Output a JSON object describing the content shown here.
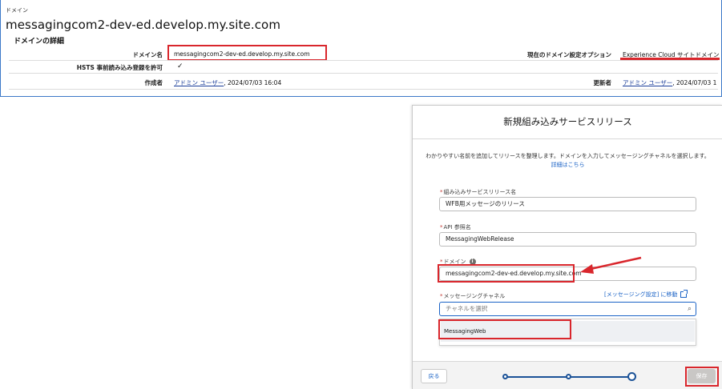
{
  "domain": {
    "object_type": "ドメイン",
    "title": "messagingcom2-dev-ed.develop.my.site.com",
    "section_title": "ドメインの詳細",
    "fields": {
      "domain_name_label": "ドメイン名",
      "domain_name_value": "messagingcom2-dev-ed.develop.my.site.com",
      "hsts_label": "HSTS 事前読み込み登録を許可",
      "hsts_value": "✓",
      "created_by_label": "作成者",
      "created_by_user": "アドミン ユーザー",
      "created_by_date": ", 2024/07/03 16:04",
      "current_option_label": "現在のドメイン設定オプション",
      "current_option_value": "Experience Cloud サイトドメイン",
      "modified_by_label": "更新者",
      "modified_by_user": "アドミン ユーザー",
      "modified_by_date": ", 2024/07/03 1"
    }
  },
  "modal": {
    "title": "新規組み込みサービスリリース",
    "description": "わかりやすい名前を追加してリリースを整理します。ドメインを入力してメッセージングチャネルを選択します。",
    "description_link": "詳細はこちら",
    "fields": {
      "release_name_label": "組み込みサービスリリース名",
      "release_name_value": "WFB用メッセージのリリース",
      "api_name_label": "API 参照名",
      "api_name_value": "MessagingWebRelease",
      "domain_label": "ドメイン",
      "domain_value": "messagingcom2-dev-ed.develop.my.site.com",
      "channel_label": "メッセージングチャネル",
      "channel_placeholder": "チャネルを選択",
      "channel_link": "[メッセージング設定] に移動",
      "channel_option": "MessagingWeb"
    },
    "footer": {
      "back_label": "戻る",
      "save_label": "保存"
    },
    "progress": {
      "steps": 3,
      "current_step": 3
    }
  },
  "colors": {
    "highlight": "#d9262c",
    "link": "#1b63c6",
    "progress": "#1b5297"
  },
  "icons": [
    "check-icon",
    "info-icon",
    "search-icon",
    "external-link-icon",
    "arrow-annotation-icon"
  ]
}
